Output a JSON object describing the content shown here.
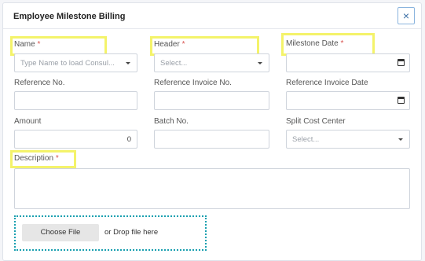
{
  "dialog": {
    "title": "Employee Milestone Billing",
    "close_label": "×"
  },
  "fields": {
    "name": {
      "label": "Name",
      "required_mark": "*",
      "placeholder": "Type Name to load Consul..."
    },
    "header": {
      "label": "Header",
      "required_mark": "*",
      "placeholder": "Select..."
    },
    "milestone_date": {
      "label": "Milestone Date",
      "required_mark": "*",
      "value": ""
    },
    "reference_no": {
      "label": "Reference No.",
      "value": ""
    },
    "reference_invoice_no": {
      "label": "Reference Invoice No.",
      "value": ""
    },
    "reference_invoice_date": {
      "label": "Reference Invoice Date",
      "value": ""
    },
    "amount": {
      "label": "Amount",
      "value": "0"
    },
    "batch_no": {
      "label": "Batch No.",
      "value": ""
    },
    "split_cost_center": {
      "label": "Split Cost Center",
      "placeholder": "Select..."
    },
    "description": {
      "label": "Description",
      "required_mark": "*",
      "value": ""
    }
  },
  "upload": {
    "choose_label": "Choose File",
    "drop_text": "or Drop file here"
  },
  "icons": {
    "dropdown": "chevron-down-icon",
    "calendar": "calendar-icon",
    "close": "close-icon"
  },
  "colors": {
    "highlight": "#f4f36a",
    "required": "#d9534f",
    "drop_border": "#1aa0b0",
    "close_border": "#8ab4de"
  }
}
